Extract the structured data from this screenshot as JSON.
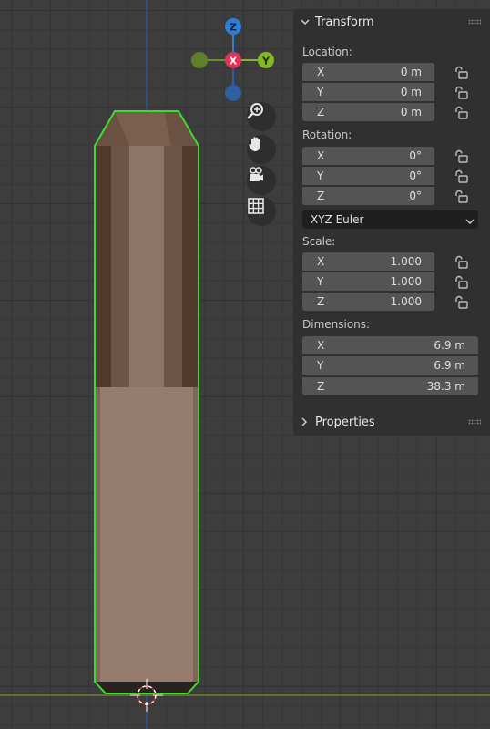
{
  "gizmo": {
    "z_label": "Z",
    "x_label": "X",
    "y_label": "Y"
  },
  "navigation": [
    {
      "name": "zoom-icon"
    },
    {
      "name": "hand-pan-icon"
    },
    {
      "name": "camera-icon"
    },
    {
      "name": "grid-icon"
    }
  ],
  "transform_panel": {
    "title": "Transform",
    "location": {
      "label": "Location:",
      "fields": [
        {
          "axis": "X",
          "value": "0 m"
        },
        {
          "axis": "Y",
          "value": "0 m"
        },
        {
          "axis": "Z",
          "value": "0 m"
        }
      ]
    },
    "rotation": {
      "label": "Rotation:",
      "fields": [
        {
          "axis": "X",
          "value": "0°"
        },
        {
          "axis": "Y",
          "value": "0°"
        },
        {
          "axis": "Z",
          "value": "0°"
        }
      ],
      "mode": "XYZ Euler"
    },
    "scale": {
      "label": "Scale:",
      "fields": [
        {
          "axis": "X",
          "value": "1.000"
        },
        {
          "axis": "Y",
          "value": "1.000"
        },
        {
          "axis": "Z",
          "value": "1.000"
        }
      ]
    },
    "dimensions": {
      "label": "Dimensions:",
      "fields": [
        {
          "axis": "X",
          "value": "6.9 m"
        },
        {
          "axis": "Y",
          "value": "6.9 m"
        },
        {
          "axis": "Z",
          "value": "38.3 m"
        }
      ]
    }
  },
  "properties_panel": {
    "title": "Properties"
  },
  "colors": {
    "selection_outline": "#3ddc2f",
    "x_axis": "#e8315a",
    "y_axis": "#84b626",
    "z_axis": "#2f7fd8",
    "object_light": "#8c7566",
    "object_dark": "#5c4536"
  }
}
